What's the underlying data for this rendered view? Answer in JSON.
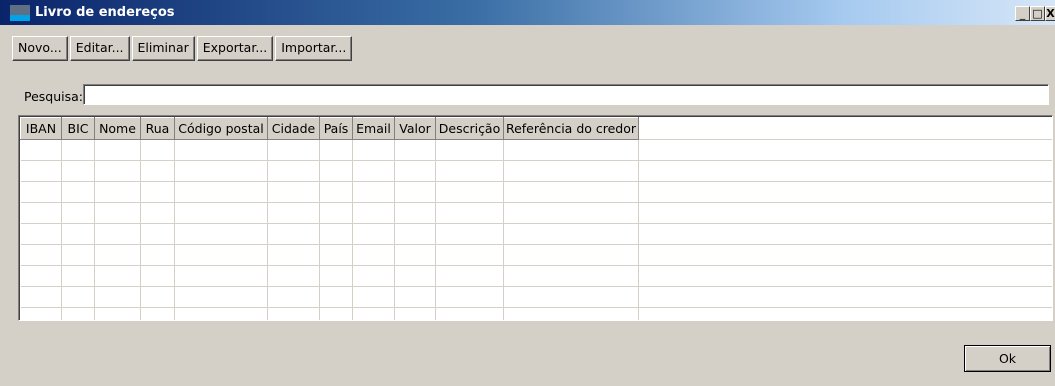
{
  "window": {
    "title": "Livro de endereços",
    "controls": {
      "minimize": "_",
      "maximize": "□",
      "close": "X"
    }
  },
  "toolbar": {
    "new_label": "Novo...",
    "edit_label": "Editar...",
    "delete_label": "Eliminar",
    "export_label": "Exportar...",
    "import_label": "Importar..."
  },
  "search": {
    "label": "Pesquisa:",
    "value": "",
    "placeholder": ""
  },
  "table": {
    "columns": [
      "IBAN",
      "BIC",
      "Nome",
      "Rua",
      "Código postal",
      "Cidade",
      "País",
      "Email",
      "Valor",
      "Descrição",
      "Referência do credor"
    ],
    "rows": []
  },
  "footer": {
    "ok_label": "Ok"
  }
}
